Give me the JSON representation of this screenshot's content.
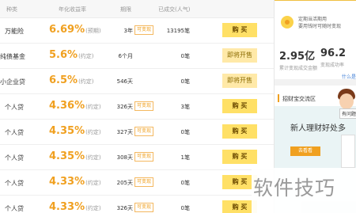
{
  "header": {
    "col_type": "种类",
    "col_rate": "年化收益率",
    "col_term": "期限",
    "col_sold": "已成交(人气)"
  },
  "rows": [
    {
      "type": "万能险",
      "rate": "6.69%",
      "rate_note": "(预期)",
      "term": "3年",
      "badge": "可变现",
      "sold": "13195笔",
      "action": "购 买",
      "action_kind": "buy"
    },
    {
      "type": "纯债基金",
      "rate": "5.6%",
      "rate_note": "(约定)",
      "term": "6个月",
      "badge": "",
      "sold": "0笔",
      "action": "即将开售",
      "action_kind": "soon"
    },
    {
      "type": "小企业贷",
      "rate": "6.5%",
      "rate_note": "(约定)",
      "term": "546天",
      "badge": "",
      "sold": "0笔",
      "action": "即将开售",
      "action_kind": "soon"
    },
    {
      "type": "个人贷",
      "rate": "4.36%",
      "rate_note": "(约定)",
      "term": "326天",
      "badge": "可变现",
      "sold": "3笔",
      "action": "购 买",
      "action_kind": "buy"
    },
    {
      "type": "个人贷",
      "rate": "4.35%",
      "rate_note": "(约定)",
      "term": "327天",
      "badge": "可变现",
      "sold": "0笔",
      "action": "购 买",
      "action_kind": "buy"
    },
    {
      "type": "个人贷",
      "rate": "4.35%",
      "rate_note": "(约定)",
      "term": "308天",
      "badge": "可变现",
      "sold": "1笔",
      "action": "购 买",
      "action_kind": "buy"
    },
    {
      "type": "个人贷",
      "rate": "4.33%",
      "rate_note": "(约定)",
      "term": "205天",
      "badge": "可变现",
      "sold": "0笔",
      "action": "购 买",
      "action_kind": "buy"
    },
    {
      "type": "个人贷",
      "rate": "4.33%",
      "rate_note": "(约定)",
      "term": "326天",
      "badge": "可变现",
      "sold": "0笔",
      "action": "购 买",
      "action_kind": "buy"
    }
  ],
  "sidebar": {
    "promo_line1": "定期当活期用",
    "promo_line2": "要用钱时可随时变现",
    "stat1_value": "2.95亿",
    "stat1_label": "累计变现成交金额",
    "stat2_value": "96.2",
    "stat2_label": "变现成功率",
    "more_link": "什么是",
    "section_title": "招财宝交流区",
    "bubble_text": "有问题",
    "headline": "新人理财好处多",
    "cta": "去看看"
  },
  "watermark": "软件技巧",
  "colors": {
    "accent": "#f0a020",
    "buy_button": "#ffe066"
  }
}
